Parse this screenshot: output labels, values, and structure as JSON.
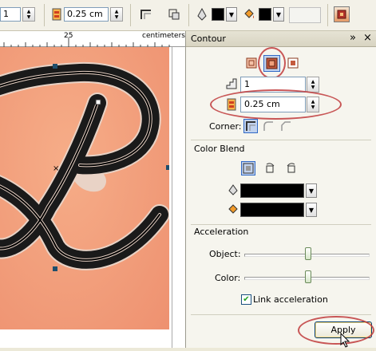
{
  "toolbar": {
    "steps_value": "1",
    "offset_value": "0.25 cm"
  },
  "ruler": {
    "tick_label": "25",
    "units_label": "centimeters"
  },
  "panel": {
    "title": "Contour",
    "expand_glyph": "»",
    "close_glyph": "×",
    "steps_value": "1",
    "offset_value": "0.25 cm",
    "corner_label": "Corner:",
    "color_blend_label": "Color Blend",
    "acceleration_label": "Acceleration",
    "object_label": "Object:",
    "color_label": "Color:",
    "link_label": "Link acceleration",
    "link_checked": "✔",
    "apply_label": "Apply"
  },
  "colors": {
    "outline_color": "#000000",
    "fill_color": "#000000",
    "page_color": "#f0a07c",
    "highlight": "#c0393b"
  },
  "sliders": {
    "object_level_fraction": 0.51,
    "color_level_fraction": 0.51
  }
}
